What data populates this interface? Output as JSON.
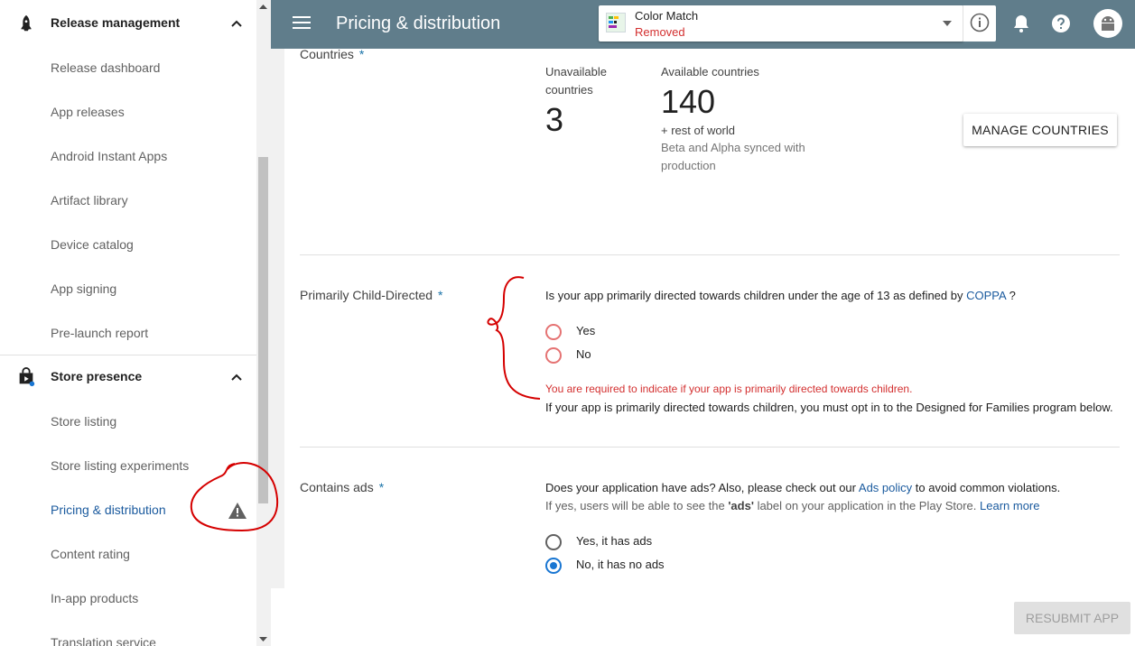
{
  "sidebar": {
    "sections": [
      {
        "label": "Release management",
        "icon": "rocket-icon"
      },
      {
        "label": "Store presence",
        "icon": "shopping-bag-icon"
      }
    ],
    "release_items": [
      "Release dashboard",
      "App releases",
      "Android Instant Apps",
      "Artifact library",
      "Device catalog",
      "App signing",
      "Pre-launch report"
    ],
    "store_items": [
      "Store listing",
      "Store listing experiments",
      "Pricing & distribution",
      "Content rating",
      "In-app products",
      "Translation service"
    ],
    "active_item": "Pricing & distribution"
  },
  "header": {
    "title": "Pricing & distribution",
    "app_name": "Color Match",
    "app_status": "Removed",
    "colors": {
      "bar": "#607d8b",
      "status": "#d32f2f"
    }
  },
  "countries": {
    "label": "Countries",
    "unavailable_label": "Unavailable countries",
    "unavailable_count": "3",
    "available_label": "Available countries",
    "available_count": "140",
    "rest_of_world": "+ rest of world",
    "sync_note": "Beta and Alpha synced with production",
    "manage_button": "MANAGE COUNTRIES"
  },
  "child_directed": {
    "label": "Primarily Child-Directed",
    "question_prefix": "Is your app primarily directed towards children under the age of 13 as defined by",
    "question_link": "COPPA",
    "question_suffix": "?",
    "options": [
      "Yes",
      "No"
    ],
    "error": "You are required to indicate if your app is primarily directed towards children.",
    "helper": "If your app is primarily directed towards children, you must opt in to the Designed for Families program below."
  },
  "ads": {
    "label": "Contains ads",
    "question_prefix": "Does your application have ads? Also, please check out our",
    "question_link": "Ads policy",
    "question_suffix": "to avoid common violations.",
    "helper_prefix": "If yes, users will be able to see the",
    "helper_bold": "'ads'",
    "helper_mid": "label on your application in the Play Store.",
    "helper_link": "Learn more",
    "options": [
      "Yes, it has ads",
      "No, it has no ads"
    ],
    "selected": "No, it has no ads"
  },
  "required_mark": "*",
  "footer": {
    "resubmit": "RESUBMIT APP"
  }
}
